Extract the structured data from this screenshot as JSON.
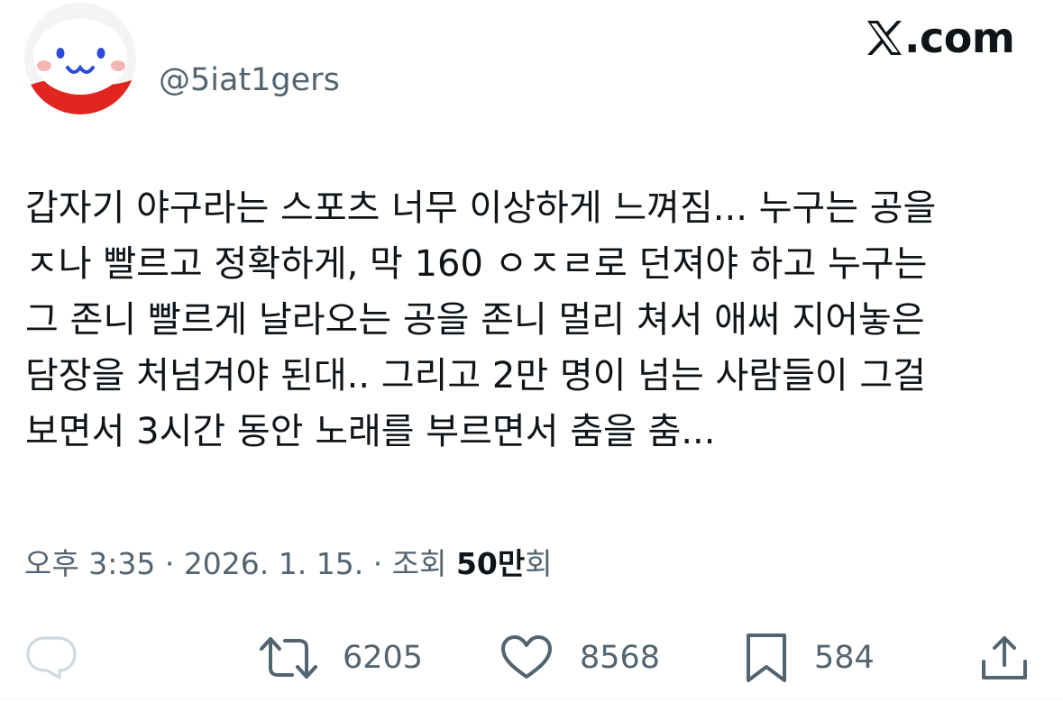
{
  "header": {
    "handle": "@5iat1gers",
    "site": ".com",
    "site_logo_icon": "x-logo-icon",
    "avatar_icon": "smiling-face-avatar"
  },
  "tweet": {
    "lines": [
      "갑자기 야구라는 스포츠 너무 이상하게 느껴짐... 누구는 공을",
      "ㅈ나 빨르고 정확하게, 막 160 ㅇㅈㄹ로 던져야 하고 누구는",
      "그 존니 빨르게 날라오는 공을 존니 멀리 쳐서 애써 지어놓은",
      "담장을 처넘겨야 된대.. 그리고 2만 명이 넘는 사람들이 그걸",
      "보면서 3시간 동안 노래를 부르면서 춤을 춤..."
    ]
  },
  "meta": {
    "time": "오후 3:35",
    "separator": " · ",
    "date": "2026. 1. 15.",
    "views_label": "조회",
    "views_count": "50만",
    "views_suffix": "회"
  },
  "actions": {
    "reply_icon": "reply-icon",
    "retweet_icon": "retweet-icon",
    "retweet_count": "6205",
    "like_icon": "heart-icon",
    "like_count": "8568",
    "bookmark_icon": "bookmark-icon",
    "bookmark_count": "584",
    "share_icon": "share-icon"
  },
  "colors": {
    "text": "#0f1419",
    "secondary": "#536471",
    "avatar_red": "#e0261f",
    "avatar_blue": "#2b4bd8",
    "avatar_cheek": "#f6b5b5"
  }
}
